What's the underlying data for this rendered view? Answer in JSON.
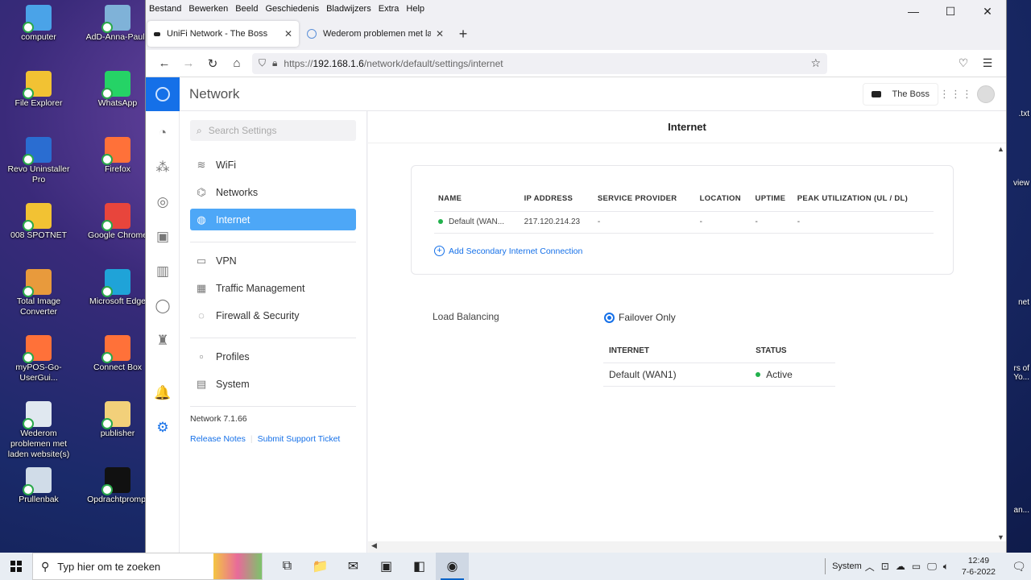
{
  "desktop": {
    "icons": [
      {
        "label": "computer",
        "color": "#4aa3e8"
      },
      {
        "label": "AdD-Anna-Paulo",
        "color": "#7fb2d8"
      },
      {
        "label": "File Explorer",
        "color": "#f2c233"
      },
      {
        "label": "WhatsApp",
        "color": "#25d366"
      },
      {
        "label": "Revo Uninstaller Pro",
        "color": "#2a6dd1"
      },
      {
        "label": "Firefox",
        "color": "#ff7139"
      },
      {
        "label": "008 SPOTNET",
        "color": "#f2c233"
      },
      {
        "label": "Google Chrome",
        "color": "#e8453c"
      },
      {
        "label": "Total Image Converter",
        "color": "#e89a3c"
      },
      {
        "label": "Microsoft Edge",
        "color": "#1fa3d8"
      },
      {
        "label": "myPOS-Go-UserGui...",
        "color": "#ff7139"
      },
      {
        "label": "Connect Box",
        "color": "#ff7139"
      },
      {
        "label": "Wederom problemen met laden website(s)",
        "color": "#e0e8f0"
      },
      {
        "label": "publisher",
        "color": "#f2d07a"
      },
      {
        "label": "Prullenbak",
        "color": "#d0dce8"
      },
      {
        "label": "Opdrachtprompt",
        "color": "#111111"
      }
    ],
    "right_snippets": [
      ".txt",
      "view",
      "net",
      "rs of\nYo...",
      "an..."
    ]
  },
  "browser": {
    "menu": [
      "Bestand",
      "Bewerken",
      "Beeld",
      "Geschiedenis",
      "Bladwijzers",
      "Extra",
      "Help"
    ],
    "window_controls": {
      "minimize": "—",
      "maximize": "☐",
      "close": "✕"
    },
    "tabs": [
      {
        "label": "UniFi Network - The Boss",
        "close": "✕"
      },
      {
        "label": "Wederom problemen met laden",
        "close": "✕"
      }
    ],
    "new_tab": "+",
    "nav": {
      "back": "←",
      "forward": "→",
      "reload": "↻",
      "home": "⌂"
    },
    "url": {
      "scheme": "https://",
      "host": "192.168.1.6",
      "path": "/network/default/settings/internet"
    },
    "star": "☆",
    "right_icons": {
      "pocket": "♡",
      "menu": "☰"
    }
  },
  "app": {
    "title": "Network",
    "console_name": "The Boss",
    "grid_icon": "⋮⋮⋮",
    "settings_search_placeholder": "Search Settings",
    "nav_groups": [
      [
        {
          "label": "WiFi",
          "icon": "wifi-icon",
          "glyph": "≋"
        },
        {
          "label": "Networks",
          "icon": "networks-icon",
          "glyph": "⌬"
        },
        {
          "label": "Internet",
          "icon": "globe-icon",
          "glyph": "◍",
          "active": true
        }
      ],
      [
        {
          "label": "VPN",
          "icon": "vpn-icon",
          "glyph": "▭"
        },
        {
          "label": "Traffic Management",
          "icon": "traffic-icon",
          "glyph": "▦"
        },
        {
          "label": "Firewall & Security",
          "icon": "shield-icon",
          "glyph": "◌"
        }
      ],
      [
        {
          "label": "Profiles",
          "icon": "profiles-icon",
          "glyph": "▫"
        },
        {
          "label": "System",
          "icon": "system-icon",
          "glyph": "▤"
        }
      ]
    ],
    "version": "Network 7.1.66",
    "release_notes": "Release Notes",
    "support": "Submit Support Ticket",
    "rail": [
      "dashboard-icon",
      "topology-icon",
      "devices-icon",
      "clients-icon",
      "statistics-icon",
      "insights-icon",
      "system-log-icon",
      "alerts-icon",
      "settings-icon"
    ],
    "rail_glyphs": [
      "◔",
      "⁂",
      "◎",
      "▣",
      "▥",
      "◯",
      "♜",
      "🔔",
      "⚙"
    ]
  },
  "content": {
    "title": "Internet",
    "wan_table": {
      "headers": [
        "NAME",
        "IP ADDRESS",
        "SERVICE PROVIDER",
        "LOCATION",
        "UPTIME",
        "PEAK UTILIZATION (UL / DL)"
      ],
      "rows": [
        [
          "Default (WAN...",
          "217.120.214.23",
          "-",
          "-",
          "-",
          "-"
        ]
      ]
    },
    "add_secondary": "Add Secondary Internet Connection",
    "load_balancing_label": "Load Balancing",
    "load_balancing_option": "Failover Only",
    "lb_table": {
      "headers": [
        "INTERNET",
        "STATUS"
      ],
      "rows": [
        [
          "Default (WAN1)",
          "Active"
        ]
      ]
    },
    "status_color": "#22b14c",
    "accent": "#1570e8"
  },
  "taskbar": {
    "search_placeholder": "Typ hier om te zoeken",
    "apps": [
      {
        "name": "task-view-icon",
        "glyph": "⧉"
      },
      {
        "name": "file-explorer-icon",
        "glyph": "📁"
      },
      {
        "name": "mail-icon",
        "glyph": "✉"
      },
      {
        "name": "office-icon",
        "glyph": "▣"
      },
      {
        "name": "outlook-icon",
        "glyph": "◧"
      },
      {
        "name": "firefox-icon",
        "glyph": "◉",
        "active": true
      }
    ],
    "tray_label": "System",
    "time": "12:49",
    "date": "7-6-2022",
    "notifications": "17"
  }
}
